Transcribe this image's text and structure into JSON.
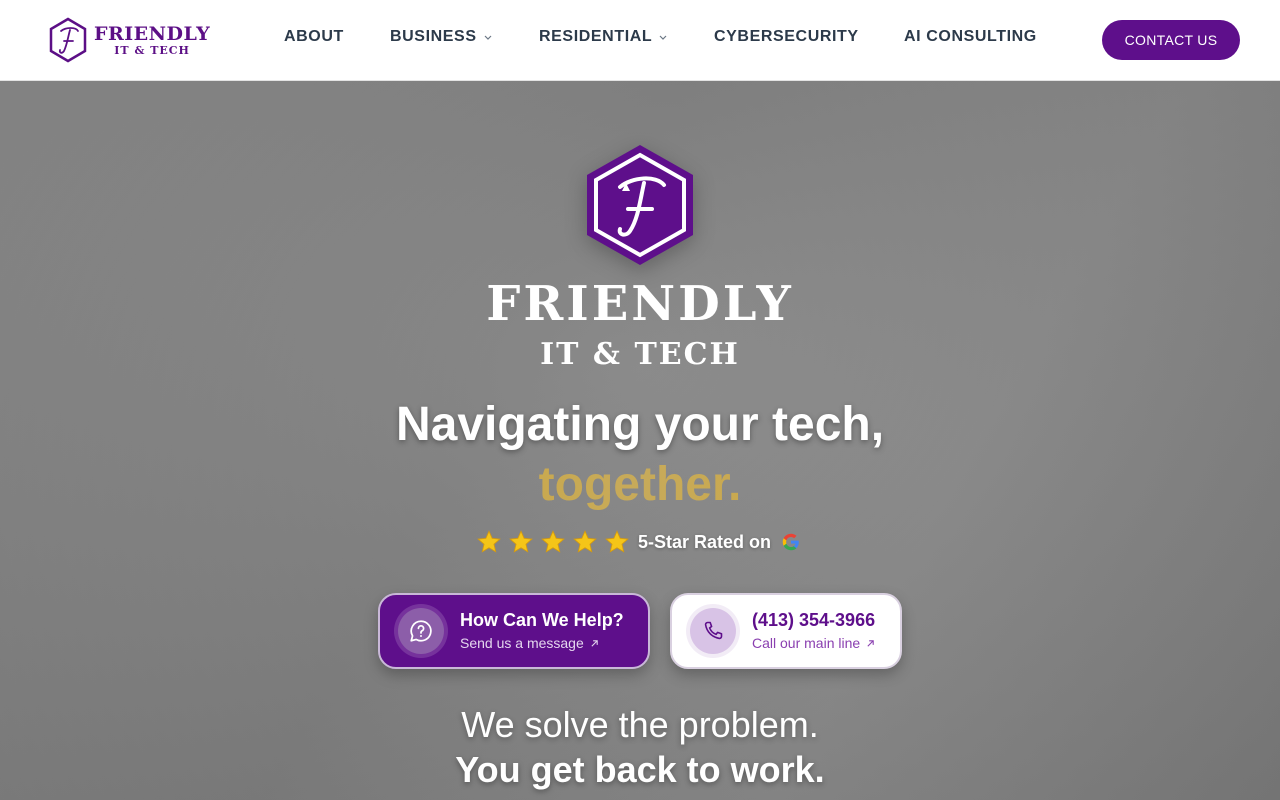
{
  "header": {
    "logo": {
      "line1": "FRIENDLY",
      "line2": "IT & TECH",
      "icon": "hexagon-f-logo"
    },
    "nav": [
      {
        "label": "ABOUT",
        "has_dropdown": false
      },
      {
        "label": "BUSINESS",
        "has_dropdown": true
      },
      {
        "label": "RESIDENTIAL",
        "has_dropdown": true
      },
      {
        "label": "CYBERSECURITY",
        "has_dropdown": false
      },
      {
        "label": "AI CONSULTING",
        "has_dropdown": false
      }
    ],
    "contact_label": "CONTACT US"
  },
  "hero": {
    "brand": {
      "line1": "FRIENDLY",
      "line2": "IT & TECH"
    },
    "headline": {
      "line1": "Navigating your tech,",
      "line2": "together."
    },
    "rating": {
      "stars": 5,
      "text": "5-Star Rated on",
      "platform_icon": "google-icon"
    },
    "cta_help": {
      "title": "How Can We Help?",
      "subtitle": "Send us a message",
      "icon": "chat-question-icon"
    },
    "cta_call": {
      "title": "(413) 354-3966",
      "subtitle": "Call our main line",
      "icon": "phone-icon"
    },
    "tagline": {
      "line1": "We solve the problem.",
      "line2": "You get back to work."
    }
  },
  "colors": {
    "brand_purple": "#5e0f8b",
    "nav_text": "#2c3a4a",
    "gold": "#d4a41a",
    "star": "#f5c518",
    "hero_bg": "#858585"
  }
}
